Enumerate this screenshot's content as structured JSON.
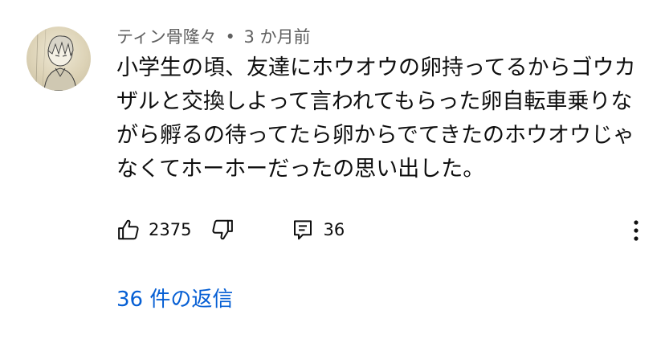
{
  "comment": {
    "author": "ティン骨隆々",
    "separator": "•",
    "timestamp": "3 か月前",
    "text": "小学生の頃、友達にホウオウの卵持ってるからゴウカザルと交換しよって言われてもらった卵自転車乗りながら孵るの待ってたら卵からでてきたのホウオウじゃなくてホーホーだったの思い出した。",
    "likes": "2375",
    "reply_count": "36",
    "replies_link": "36 件の返信"
  },
  "icons": {
    "avatar": "avatar",
    "like": "thumbs-up-icon",
    "dislike": "thumbs-down-icon",
    "reply": "comment-icon",
    "more": "more-vert-icon"
  },
  "colors": {
    "text": "#0f0f0f",
    "meta": "#606060",
    "link": "#065fd4"
  }
}
